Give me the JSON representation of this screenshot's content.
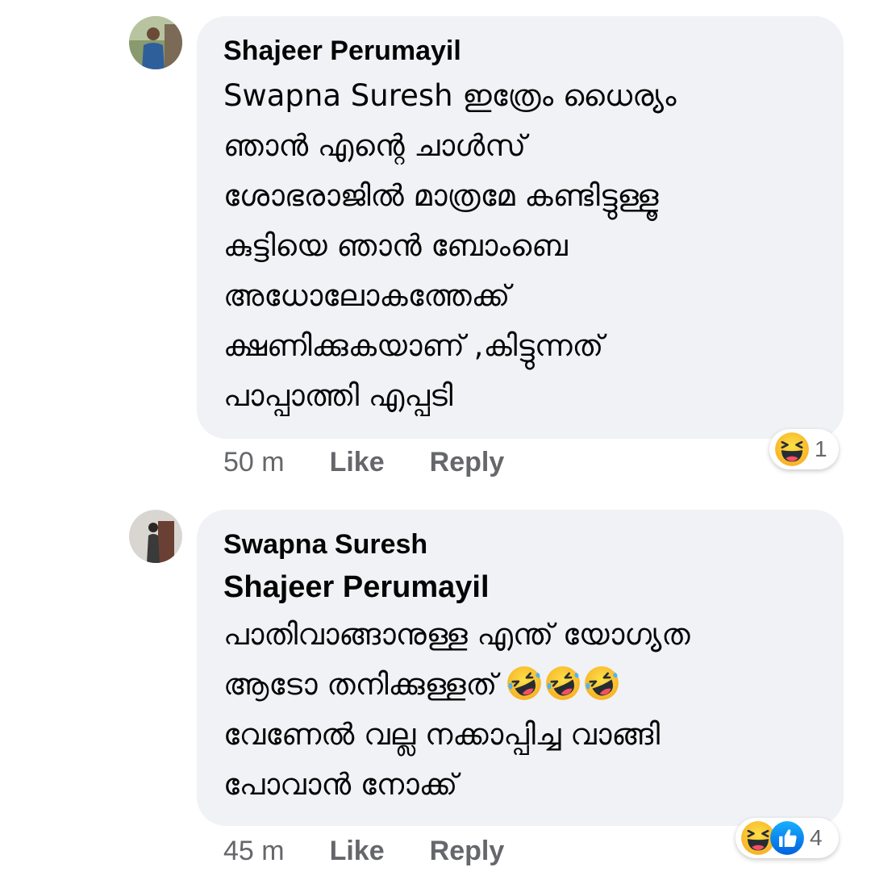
{
  "comments": [
    {
      "author": "Shajeer Perumayil",
      "mention": "",
      "lines": [
        "Swapna Suresh ഇത്രേം ധൈര്യം",
        "ഞാൻ എന്റെ ചാൾസ്",
        "ശോഭരാജിൽ മാത്രമേ കണ്ടിട്ടുള്ളൂ",
        "കുട്ടിയെ ഞാൻ ബോംബെ",
        "അധോലോകത്തേക്ക്",
        "ക്ഷണിക്കുകയാണ് ,കിട്ടുന്നത്",
        "പാപ്പാത്തി എപ്പടി"
      ],
      "time": "50 m",
      "like_label": "Like",
      "reply_label": "Reply",
      "reactions": [
        "haha"
      ],
      "reaction_count": "1"
    },
    {
      "author": "Swapna Suresh",
      "mention": "Shajeer Perumayil",
      "lines": [
        "പാതിവാങ്ങാനുള്ള എന്ത് യോഗ്യത",
        "ആടോ തനിക്കുള്ളത്",
        "വേണേൽ വല്ല നക്കാപ്പിച്ച വാങ്ങി",
        "പോവാൻ നോക്ക്"
      ],
      "inline_emojis": [
        "rofl-emoji",
        "rofl-emoji",
        "rofl-emoji"
      ],
      "time": "45 m",
      "like_label": "Like",
      "reply_label": "Reply",
      "reactions": [
        "haha",
        "like"
      ],
      "reaction_count": "4"
    }
  ],
  "colors": {
    "bubble_bg": "#f0f2f5",
    "meta_text": "#65676b",
    "like_blue": "#1877f2",
    "emoji_yellow": "#f7b125"
  }
}
